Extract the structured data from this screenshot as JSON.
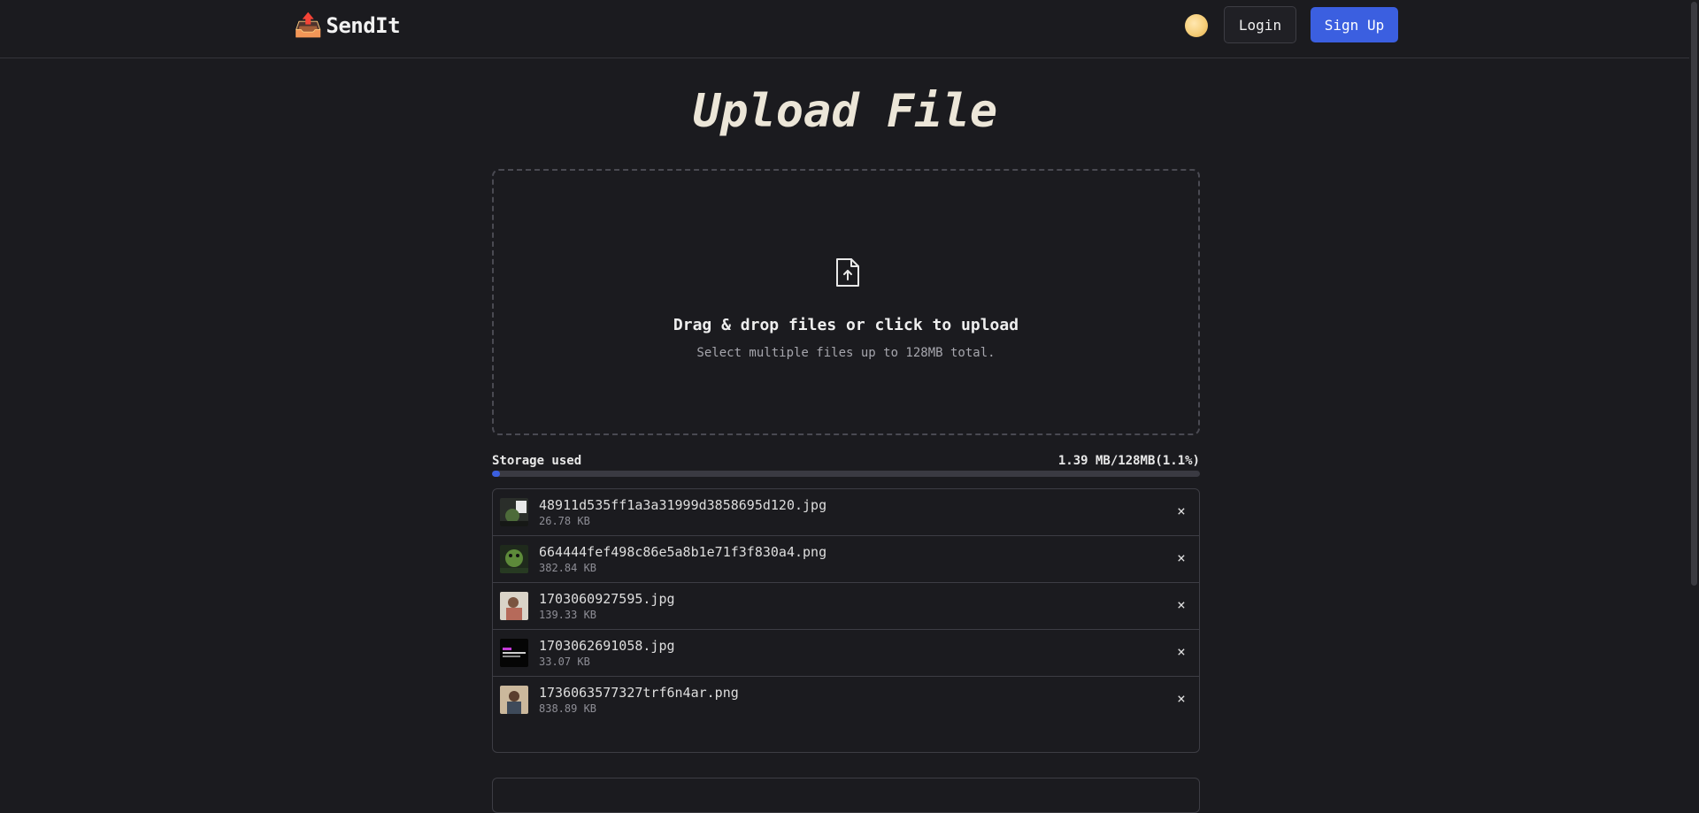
{
  "header": {
    "brand_icon": "📤",
    "brand_name": "SendIt",
    "theme_toggle_icon": "moon-icon",
    "login_label": "Login",
    "signup_label": "Sign Up"
  },
  "page": {
    "title": "Upload File"
  },
  "dropzone": {
    "icon": "file-upload-icon",
    "title": "Drag & drop files or click to upload",
    "subtitle": "Select multiple files up to 128MB total."
  },
  "storage": {
    "label": "Storage used",
    "value_text": "1.39 MB/128MB(1.1%)",
    "percent": 1.1
  },
  "files": [
    {
      "name": "48911d535ff1a3a31999d3858695d120.jpg",
      "size": "26.78 KB",
      "remove": "×"
    },
    {
      "name": "664444fef498c86e5a8b1e71f3f830a4.png",
      "size": "382.84 KB",
      "remove": "×"
    },
    {
      "name": "1703060927595.jpg",
      "size": "139.33 KB",
      "remove": "×"
    },
    {
      "name": "1703062691058.jpg",
      "size": "33.07 KB",
      "remove": "×"
    },
    {
      "name": "1736063577327trf6n4ar.png",
      "size": "838.89 KB",
      "remove": "×"
    }
  ],
  "colors": {
    "background": "#1b1b1f",
    "accent": "#3b5fe0",
    "border": "#3d3d44",
    "text": "#e6e6e6"
  }
}
